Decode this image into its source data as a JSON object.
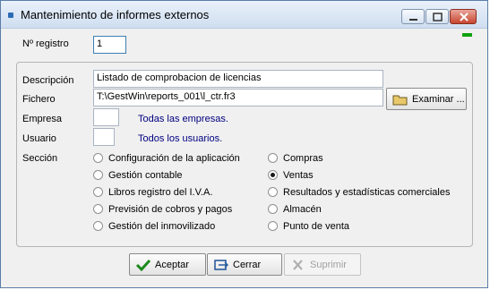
{
  "window": {
    "title": "Mantenimiento de informes externos"
  },
  "registro": {
    "label": "Nº registro",
    "value": "1"
  },
  "descripcion": {
    "label": "Descripción",
    "value": "Listado de comprobacion de licencias"
  },
  "fichero": {
    "label": "Fichero",
    "value": "T:\\GestWin\\reports_001\\l_ctr.fr3",
    "button_label": "Examinar ..."
  },
  "empresa": {
    "label": "Empresa",
    "value": "",
    "note": "Todas las empresas."
  },
  "usuario": {
    "label": "Usuario",
    "value": "",
    "note": "Todos los usuarios."
  },
  "seccion": {
    "label": "Sección",
    "options_left": [
      "Configuración de la aplicación",
      "Gestión contable",
      "Libros registro del I.V.A.",
      "Previsión de cobros y pagos",
      "Gestión del inmovilizado"
    ],
    "options_right": [
      "Compras",
      "Ventas",
      "Resultados y estadísticas comerciales",
      "Almacén",
      "Punto de venta"
    ],
    "selected": "Ventas"
  },
  "buttons": {
    "accept": "Aceptar",
    "close": "Cerrar",
    "delete": "Suprimir"
  },
  "colors": {
    "note_text": "#000080",
    "status_led": "#0fa30f",
    "accept_icon": "#1d8a1d",
    "close_icon": "#2b5c9e"
  }
}
